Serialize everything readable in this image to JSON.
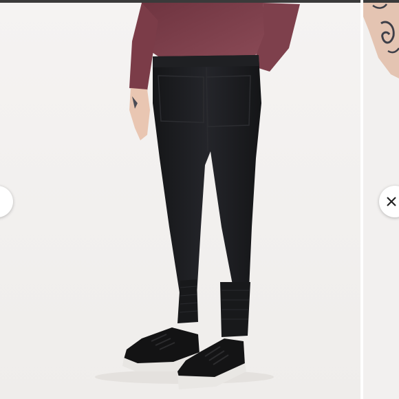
{
  "gallery": {
    "main_image": {
      "label": "",
      "subject": "black-jogger-pants-photo"
    },
    "next_image": {
      "subject": "tattooed-arm-photo"
    },
    "prev_button": {
      "icon": "chevron-left-icon"
    },
    "next_button": {
      "icon": "close-icon"
    }
  },
  "colors": {
    "backdrop": "#f4f2f1",
    "top": "#7a3e4a",
    "pants": "#1b1c1e",
    "shoes": "#141414",
    "soles": "#e9e7e4",
    "button": "#ffffff"
  }
}
